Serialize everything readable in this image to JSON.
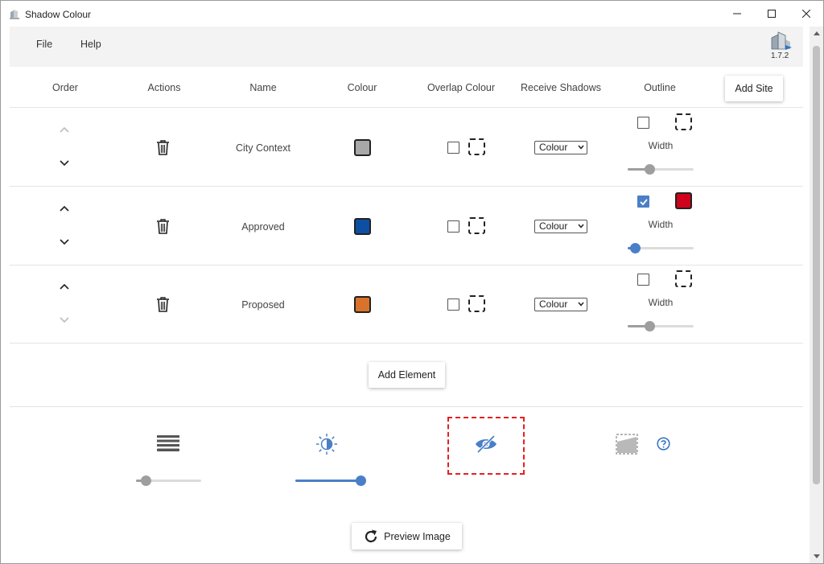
{
  "window": {
    "title": "Shadow Colour"
  },
  "menu": {
    "file": "File",
    "help": "Help",
    "version": "1.7.2"
  },
  "columns": {
    "order": "Order",
    "actions": "Actions",
    "name": "Name",
    "colour": "Colour",
    "overlap_colour": "Overlap Colour",
    "receive_shadows": "Receive Shadows",
    "outline": "Outline"
  },
  "add_site_label": "Add Site",
  "rows": [
    {
      "name": "City Context",
      "colour": "#a8a8a8",
      "receive_shadows": "Colour",
      "outline_checked": false,
      "outline_colour": "none",
      "width_label": "Width",
      "width_value": 0.33,
      "slider_color": "#9e9e9e",
      "up_enabled": false,
      "down_enabled": true
    },
    {
      "name": "Approved",
      "colour": "#0d4fa3",
      "receive_shadows": "Colour",
      "outline_checked": true,
      "outline_colour": "#d0021b",
      "width_label": "Width",
      "width_value": 0.12,
      "slider_color": "#4a7fc8",
      "up_enabled": true,
      "down_enabled": true
    },
    {
      "name": "Proposed",
      "colour": "#d9732b",
      "receive_shadows": "Colour",
      "outline_checked": false,
      "outline_colour": "none",
      "width_label": "Width",
      "width_value": 0.33,
      "slider_color": "#9e9e9e",
      "up_enabled": true,
      "down_enabled": false
    }
  ],
  "add_element_label": "Add Element",
  "tools": {
    "layers_slider_value": 0.15,
    "brightness_slider_value": 1.0,
    "icons": [
      "layers-icon",
      "brightness-icon",
      "visibility-off-icon",
      "shadow-plane-icon",
      "help-icon"
    ]
  },
  "preview_label": "Preview Image",
  "accent_color": "#4a7fc8"
}
